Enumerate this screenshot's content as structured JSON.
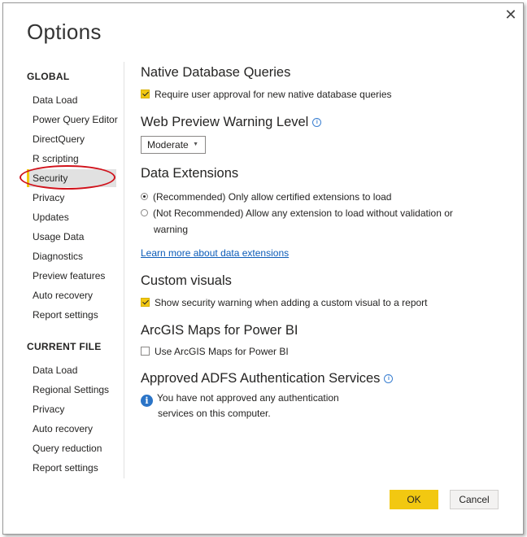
{
  "dialog": {
    "title": "Options"
  },
  "nav": {
    "global_header": "GLOBAL",
    "global_items": [
      "Data Load",
      "Power Query Editor",
      "DirectQuery",
      "R scripting",
      "Security",
      "Privacy",
      "Updates",
      "Usage Data",
      "Diagnostics",
      "Preview features",
      "Auto recovery",
      "Report settings"
    ],
    "selected": "Security",
    "current_header": "CURRENT FILE",
    "current_items": [
      "Data Load",
      "Regional Settings",
      "Privacy",
      "Auto recovery",
      "Query reduction",
      "Report settings"
    ]
  },
  "native_db": {
    "title": "Native Database Queries",
    "checkbox_label": "Require user approval for new native database queries",
    "checked": true
  },
  "web_preview": {
    "title": "Web Preview Warning Level",
    "value": "Moderate"
  },
  "data_ext": {
    "title": "Data Extensions",
    "option1": "(Recommended) Only allow certified extensions to load",
    "option2_line1": "(Not Recommended) Allow any extension to load without validation or",
    "option2_line2": "warning",
    "selected": "option1",
    "link": "Learn more about data extensions"
  },
  "custom_visuals": {
    "title": "Custom visuals",
    "checkbox_label": "Show security warning when adding a custom visual to a report",
    "checked": true
  },
  "arcgis": {
    "title": "ArcGIS Maps for Power BI",
    "checkbox_label": "Use ArcGIS Maps for Power BI",
    "checked": false
  },
  "adfs": {
    "title": "Approved ADFS Authentication Services",
    "message_line1": "You have not approved any authentication",
    "message_line2": "services on this computer."
  },
  "footer": {
    "ok": "OK",
    "cancel": "Cancel"
  },
  "colors": {
    "accent": "#f2c811",
    "link": "#0c5cb8",
    "annotation": "#d0121b",
    "info": "#2b74c7"
  }
}
